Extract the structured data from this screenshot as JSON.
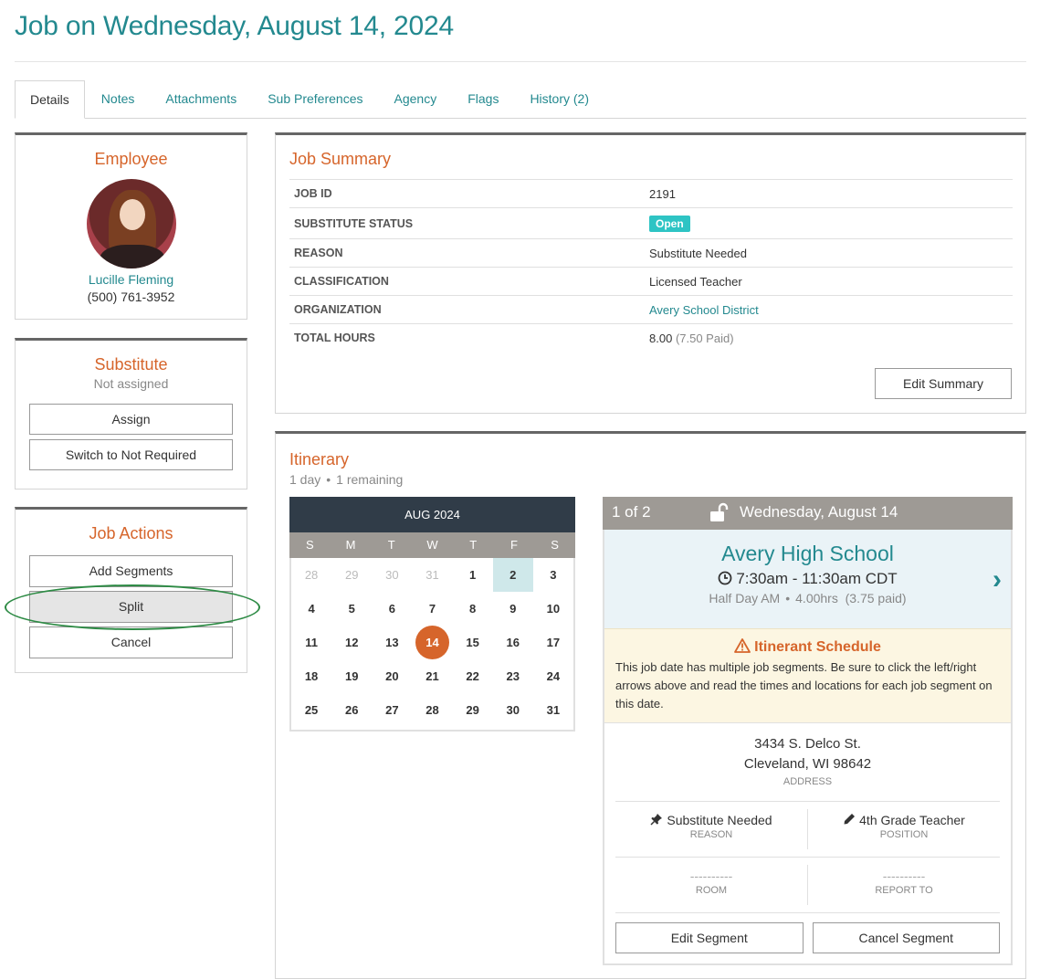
{
  "page": {
    "title": "Job on Wednesday, August 14, 2024"
  },
  "tabs": [
    {
      "label": "Details",
      "active": true
    },
    {
      "label": "Notes"
    },
    {
      "label": "Attachments"
    },
    {
      "label": "Sub Preferences"
    },
    {
      "label": "Agency"
    },
    {
      "label": "Flags"
    },
    {
      "label": "History (2)"
    }
  ],
  "employee": {
    "heading": "Employee",
    "name": "Lucille Fleming",
    "phone": "(500) 761-3952"
  },
  "substitute": {
    "heading": "Substitute",
    "status": "Not assigned",
    "assign_label": "Assign",
    "switch_label": "Switch to Not Required"
  },
  "job_actions": {
    "heading": "Job Actions",
    "add_segments_label": "Add Segments",
    "split_label": "Split",
    "cancel_label": "Cancel"
  },
  "job_summary": {
    "heading": "Job Summary",
    "rows": [
      {
        "label": "JOB ID",
        "value": "2191"
      },
      {
        "label": "SUBSTITUTE STATUS",
        "value": "Open"
      },
      {
        "label": "REASON",
        "value": "Substitute Needed"
      },
      {
        "label": "CLASSIFICATION",
        "value": "Licensed Teacher"
      },
      {
        "label": "ORGANIZATION",
        "value": "Avery School District"
      },
      {
        "label": "TOTAL HOURS",
        "value": "8.00",
        "note": "(7.50 Paid)"
      }
    ],
    "edit_label": "Edit Summary"
  },
  "itinerary": {
    "heading": "Itinerary",
    "days": "1 day",
    "remaining": "1 remaining",
    "calendar": {
      "month": "AUG 2024",
      "dow": [
        "S",
        "M",
        "T",
        "W",
        "T",
        "F",
        "S"
      ],
      "days": [
        "28",
        "29",
        "30",
        "31",
        "1",
        "2",
        "3",
        "4",
        "5",
        "6",
        "7",
        "8",
        "9",
        "10",
        "11",
        "12",
        "13",
        "14",
        "15",
        "16",
        "17",
        "18",
        "19",
        "20",
        "21",
        "22",
        "23",
        "24",
        "25",
        "26",
        "27",
        "28",
        "29",
        "30",
        "31"
      ],
      "muted_count": 4,
      "highlighted_day": "2",
      "selected_day": "14"
    },
    "segment": {
      "counter": "1 of 2",
      "date": "Wednesday, August 14",
      "school": "Avery High School",
      "time": "7:30am - 11:30am CDT",
      "shift": "Half Day AM",
      "hours": "4.00hrs",
      "paid": "(3.75 paid)",
      "warning_title": "Itinerant Schedule",
      "warning_text": "This job date has multiple job segments. Be sure to click the left/right arrows above and read the times and locations for each job segment on this date.",
      "address_line1": "3434 S. Delco St.",
      "address_line2": "Cleveland, WI 98642",
      "address_caption": "ADDRESS",
      "reason_value": "Substitute Needed",
      "reason_caption": "REASON",
      "position_value": "4th Grade Teacher",
      "position_caption": "POSITION",
      "room_value": "----------",
      "room_caption": "ROOM",
      "report_value": "----------",
      "report_caption": "REPORT TO",
      "edit_label": "Edit Segment",
      "cancel_label": "Cancel Segment"
    }
  },
  "colors": {
    "teal": "#23898f",
    "orange": "#d6652b",
    "badge": "#2ec4c4",
    "calendar_header": "#303c48",
    "highlight_ring": "#2e8b45"
  }
}
